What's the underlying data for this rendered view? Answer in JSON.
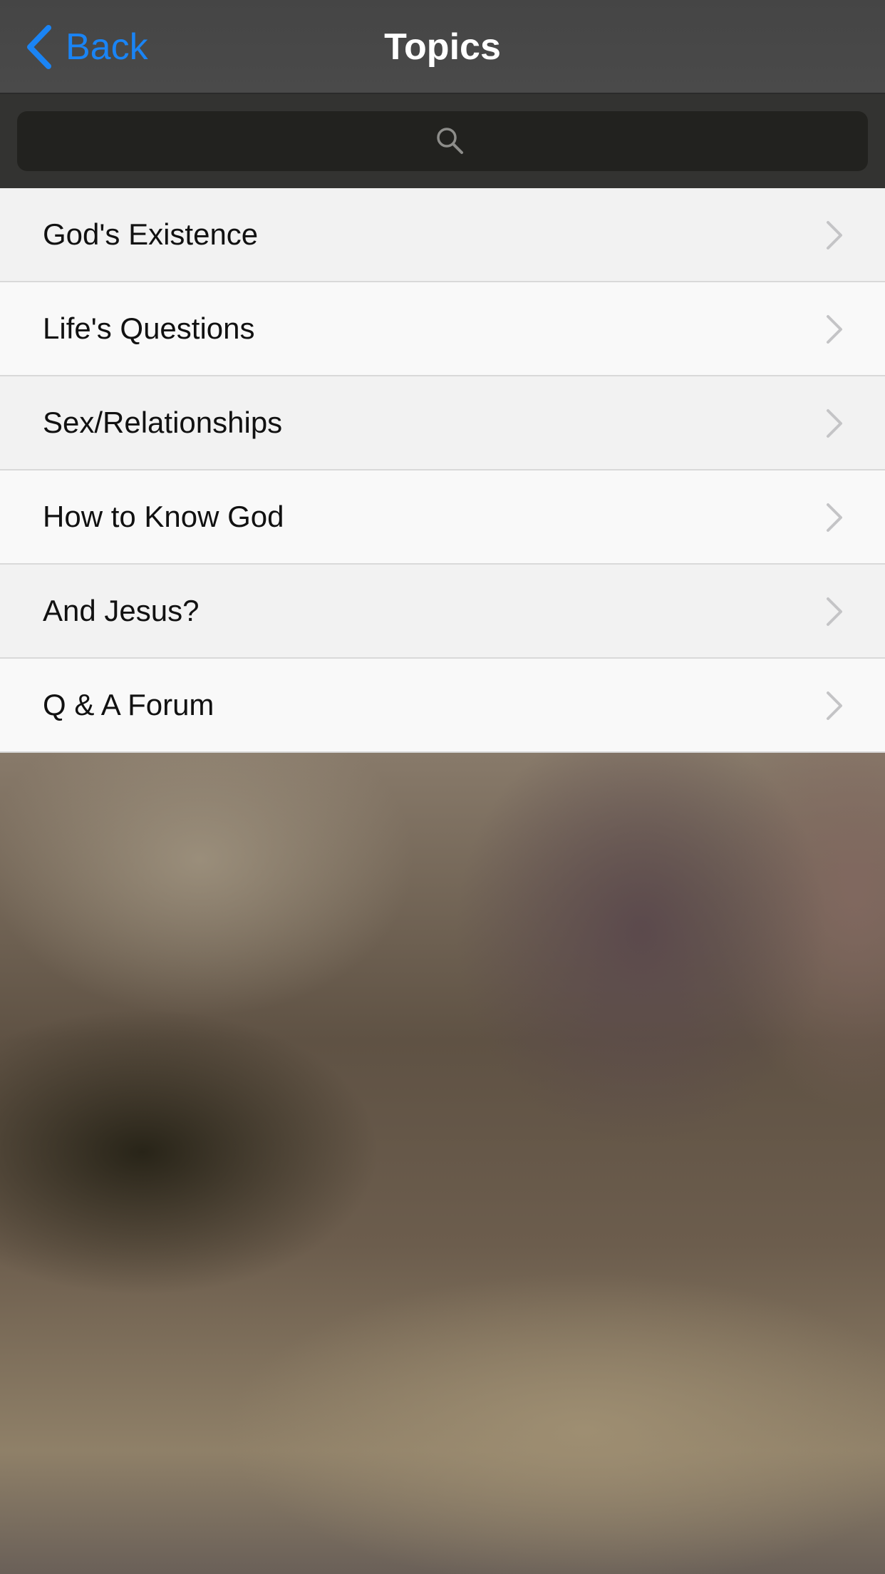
{
  "navbar": {
    "back_label": "Back",
    "back_icon": "chevron-left-icon",
    "title": "Topics",
    "accent_color": "#1a84f5"
  },
  "search": {
    "placeholder": "",
    "icon": "search-icon"
  },
  "topics": [
    {
      "label": "God's Existence"
    },
    {
      "label": "Life's Questions"
    },
    {
      "label": "Sex/Relationships"
    },
    {
      "label": "How to Know God"
    },
    {
      "label": "And Jesus?"
    },
    {
      "label": "Q & A Forum"
    }
  ]
}
